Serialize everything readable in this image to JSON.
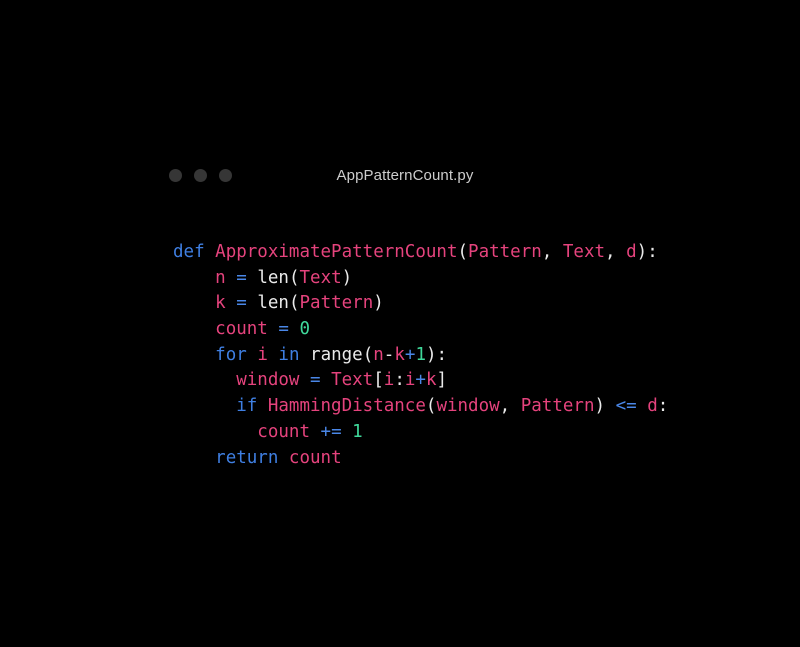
{
  "window": {
    "filename": "AppPatternCount.py",
    "traffic_lights": [
      {
        "name": "close-dot",
        "color": "#363636"
      },
      {
        "name": "minimize-dot",
        "color": "#363636"
      },
      {
        "name": "maximize-dot",
        "color": "#363636"
      }
    ]
  },
  "theme": {
    "background": "#000000",
    "keyword": "#3f7fe2",
    "operator": "#4a87e8",
    "identifier": "#e5437d",
    "number": "#3fd99b",
    "punctuation": "#eaeaea",
    "titlebar_text": "#cdcdcd",
    "dot": "#363636"
  },
  "code": {
    "language": "python",
    "plain_text": "def ApproximatePatternCount(Pattern, Text, d):\n    n = len(Text)\n    k = len(Pattern)\n    count = 0\n    for i in range(n-k+1):\n      window = Text[i:i+k]\n      if HammingDistance(window, Pattern) <= d:\n        count += 1\n    return count",
    "lines": [
      {
        "indent": "",
        "tokens": [
          {
            "text": "def",
            "type": "keyword"
          },
          {
            "text": " ",
            "type": "plain"
          },
          {
            "text": "ApproximatePatternCount",
            "type": "identifier"
          },
          {
            "text": "(",
            "type": "punctuation"
          },
          {
            "text": "Pattern",
            "type": "identifier"
          },
          {
            "text": ", ",
            "type": "punctuation"
          },
          {
            "text": "Text",
            "type": "identifier"
          },
          {
            "text": ", ",
            "type": "punctuation"
          },
          {
            "text": "d",
            "type": "identifier"
          },
          {
            "text": "):",
            "type": "punctuation"
          }
        ]
      },
      {
        "indent": "    ",
        "tokens": [
          {
            "text": "n",
            "type": "identifier"
          },
          {
            "text": " ",
            "type": "plain"
          },
          {
            "text": "=",
            "type": "operator"
          },
          {
            "text": " ",
            "type": "plain"
          },
          {
            "text": "len(",
            "type": "punctuation"
          },
          {
            "text": "Text",
            "type": "identifier"
          },
          {
            "text": ")",
            "type": "punctuation"
          }
        ]
      },
      {
        "indent": "    ",
        "tokens": [
          {
            "text": "k",
            "type": "identifier"
          },
          {
            "text": " ",
            "type": "plain"
          },
          {
            "text": "=",
            "type": "operator"
          },
          {
            "text": " ",
            "type": "plain"
          },
          {
            "text": "len(",
            "type": "punctuation"
          },
          {
            "text": "Pattern",
            "type": "identifier"
          },
          {
            "text": ")",
            "type": "punctuation"
          }
        ]
      },
      {
        "indent": "    ",
        "tokens": [
          {
            "text": "count",
            "type": "identifier"
          },
          {
            "text": " ",
            "type": "plain"
          },
          {
            "text": "=",
            "type": "operator"
          },
          {
            "text": " ",
            "type": "plain"
          },
          {
            "text": "0",
            "type": "number"
          }
        ]
      },
      {
        "indent": "    ",
        "tokens": [
          {
            "text": "for",
            "type": "keyword"
          },
          {
            "text": " ",
            "type": "plain"
          },
          {
            "text": "i",
            "type": "identifier"
          },
          {
            "text": " ",
            "type": "plain"
          },
          {
            "text": "in",
            "type": "keyword"
          },
          {
            "text": " ",
            "type": "plain"
          },
          {
            "text": "range(",
            "type": "punctuation"
          },
          {
            "text": "n",
            "type": "identifier"
          },
          {
            "text": "-",
            "type": "punctuation"
          },
          {
            "text": "k",
            "type": "identifier"
          },
          {
            "text": "+",
            "type": "operator"
          },
          {
            "text": "1",
            "type": "number"
          },
          {
            "text": "):",
            "type": "punctuation"
          }
        ]
      },
      {
        "indent": "      ",
        "tokens": [
          {
            "text": "window",
            "type": "identifier"
          },
          {
            "text": " ",
            "type": "plain"
          },
          {
            "text": "=",
            "type": "operator"
          },
          {
            "text": " ",
            "type": "plain"
          },
          {
            "text": "Text",
            "type": "identifier"
          },
          {
            "text": "[",
            "type": "punctuation"
          },
          {
            "text": "i",
            "type": "identifier"
          },
          {
            "text": ":",
            "type": "punctuation"
          },
          {
            "text": "i",
            "type": "identifier"
          },
          {
            "text": "+",
            "type": "operator"
          },
          {
            "text": "k",
            "type": "identifier"
          },
          {
            "text": "]",
            "type": "punctuation"
          }
        ]
      },
      {
        "indent": "      ",
        "tokens": [
          {
            "text": "if",
            "type": "keyword"
          },
          {
            "text": " ",
            "type": "plain"
          },
          {
            "text": "HammingDistance",
            "type": "identifier"
          },
          {
            "text": "(",
            "type": "punctuation"
          },
          {
            "text": "window",
            "type": "identifier"
          },
          {
            "text": ", ",
            "type": "punctuation"
          },
          {
            "text": "Pattern",
            "type": "identifier"
          },
          {
            "text": ") ",
            "type": "punctuation"
          },
          {
            "text": "<=",
            "type": "operator"
          },
          {
            "text": " ",
            "type": "plain"
          },
          {
            "text": "d",
            "type": "identifier"
          },
          {
            "text": ":",
            "type": "punctuation"
          }
        ]
      },
      {
        "indent": "        ",
        "tokens": [
          {
            "text": "count",
            "type": "identifier"
          },
          {
            "text": " ",
            "type": "plain"
          },
          {
            "text": "+=",
            "type": "operator"
          },
          {
            "text": " ",
            "type": "plain"
          },
          {
            "text": "1",
            "type": "number"
          }
        ]
      },
      {
        "indent": "    ",
        "tokens": [
          {
            "text": "return",
            "type": "keyword"
          },
          {
            "text": " ",
            "type": "plain"
          },
          {
            "text": "count",
            "type": "identifier"
          }
        ]
      }
    ]
  }
}
